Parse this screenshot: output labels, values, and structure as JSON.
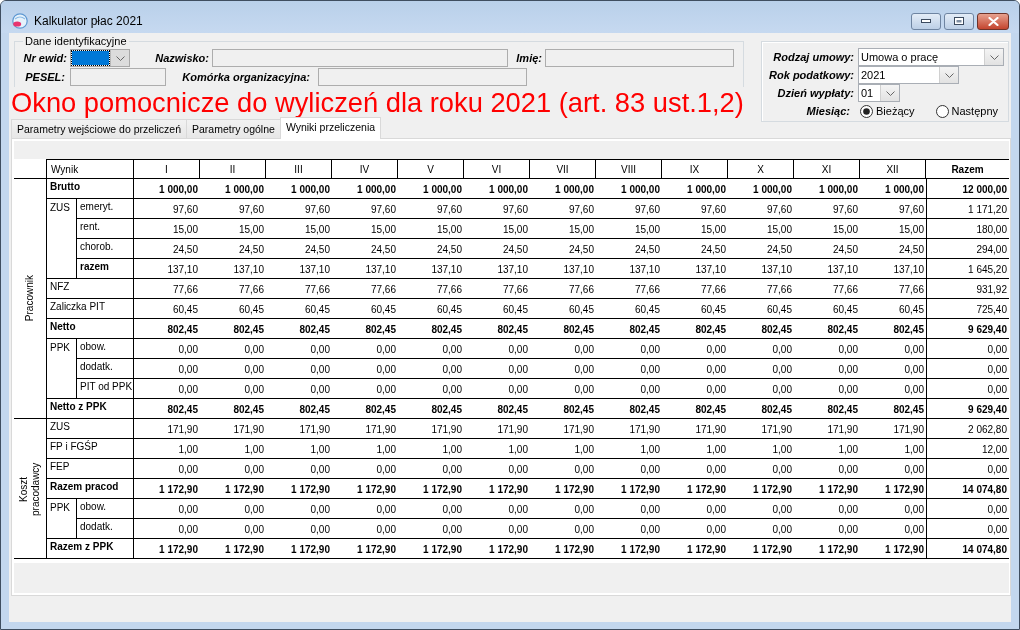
{
  "window": {
    "title": "Kalkulator płac 2021"
  },
  "identification": {
    "legend": "Dane identyfikacyjne",
    "rows": [
      [
        {
          "label": "Nr ewid:",
          "kind": "combo",
          "focused": true
        },
        {
          "label": "Nazwisko:",
          "kind": "text",
          "focused": false
        },
        {
          "label": "Imię:",
          "kind": "text",
          "focused": false
        }
      ],
      [
        {
          "label": "PESEL:",
          "kind": "text",
          "focused": false
        },
        {
          "label": "Komórka organizacyjna:",
          "kind": "text",
          "focused": false
        }
      ]
    ]
  },
  "heading": "Okno pomocnicze do wyliczeń dla roku 2021 (art. 83 ust.1,2)",
  "settings": {
    "fields": [
      {
        "label": "Rodzaj umowy:",
        "kind": "combo",
        "value": "Umowa o pracę"
      },
      {
        "label": "Rok podatkowy:",
        "kind": "combo",
        "value": "2021"
      },
      {
        "label": "Dzień wypłaty:",
        "kind": "combo",
        "value": "01"
      },
      {
        "label": "Miesiąc:",
        "kind": "radio",
        "options": [
          {
            "label": "Bieżący",
            "selected": true
          },
          {
            "label": "Następny",
            "selected": false
          }
        ]
      }
    ]
  },
  "tabs": [
    {
      "label": "Parametry wejściowe do przeliczeń",
      "selected": false
    },
    {
      "label": "Parametry ogólne",
      "selected": false
    },
    {
      "label": "Wyniki przeliczenia",
      "selected": true
    }
  ],
  "results_table": {
    "columns": [
      "Wynik",
      "I",
      "II",
      "III",
      "IV",
      "V",
      "VI",
      "VII",
      "VIII",
      "IX",
      "X",
      "XI",
      "XII",
      "Razem"
    ],
    "groups": [
      {
        "label": "Pracownik",
        "rows": [
          {
            "kind": "total",
            "label": "Brutto",
            "values": [
              "1 000,00",
              "1 000,00",
              "1 000,00",
              "1 000,00",
              "1 000,00",
              "1 000,00",
              "1 000,00",
              "1 000,00",
              "1 000,00",
              "1 000,00",
              "1 000,00",
              "1 000,00",
              "12 000,00"
            ]
          },
          {
            "kind": "group",
            "label": "ZUS",
            "rows": [
              {
                "kind": "item",
                "label": "emeryt.",
                "values": [
                  "97,60",
                  "97,60",
                  "97,60",
                  "97,60",
                  "97,60",
                  "97,60",
                  "97,60",
                  "97,60",
                  "97,60",
                  "97,60",
                  "97,60",
                  "97,60",
                  "1 171,20"
                ]
              },
              {
                "kind": "item",
                "label": "rent.",
                "values": [
                  "15,00",
                  "15,00",
                  "15,00",
                  "15,00",
                  "15,00",
                  "15,00",
                  "15,00",
                  "15,00",
                  "15,00",
                  "15,00",
                  "15,00",
                  "15,00",
                  "180,00"
                ]
              },
              {
                "kind": "item",
                "label": "chorob.",
                "values": [
                  "24,50",
                  "24,50",
                  "24,50",
                  "24,50",
                  "24,50",
                  "24,50",
                  "24,50",
                  "24,50",
                  "24,50",
                  "24,50",
                  "24,50",
                  "24,50",
                  "294,00"
                ]
              },
              {
                "kind": "subtotal",
                "label": "razem",
                "values": [
                  "137,10",
                  "137,10",
                  "137,10",
                  "137,10",
                  "137,10",
                  "137,10",
                  "137,10",
                  "137,10",
                  "137,10",
                  "137,10",
                  "137,10",
                  "137,10",
                  "1 645,20"
                ]
              }
            ]
          },
          {
            "kind": "item",
            "label": "NFZ",
            "values": [
              "77,66",
              "77,66",
              "77,66",
              "77,66",
              "77,66",
              "77,66",
              "77,66",
              "77,66",
              "77,66",
              "77,66",
              "77,66",
              "77,66",
              "931,92"
            ]
          },
          {
            "kind": "item",
            "label": "Zaliczka PIT",
            "values": [
              "60,45",
              "60,45",
              "60,45",
              "60,45",
              "60,45",
              "60,45",
              "60,45",
              "60,45",
              "60,45",
              "60,45",
              "60,45",
              "60,45",
              "725,40"
            ]
          },
          {
            "kind": "total",
            "label": "Netto",
            "values": [
              "802,45",
              "802,45",
              "802,45",
              "802,45",
              "802,45",
              "802,45",
              "802,45",
              "802,45",
              "802,45",
              "802,45",
              "802,45",
              "802,45",
              "9 629,40"
            ]
          },
          {
            "kind": "group",
            "label": "PPK",
            "rows": [
              {
                "kind": "item",
                "label": "obow.",
                "values": [
                  "0,00",
                  "0,00",
                  "0,00",
                  "0,00",
                  "0,00",
                  "0,00",
                  "0,00",
                  "0,00",
                  "0,00",
                  "0,00",
                  "0,00",
                  "0,00",
                  "0,00"
                ]
              },
              {
                "kind": "item",
                "label": "dodatk.",
                "values": [
                  "0,00",
                  "0,00",
                  "0,00",
                  "0,00",
                  "0,00",
                  "0,00",
                  "0,00",
                  "0,00",
                  "0,00",
                  "0,00",
                  "0,00",
                  "0,00",
                  "0,00"
                ]
              },
              {
                "kind": "item",
                "label": "PIT od PPK",
                "values": [
                  "0,00",
                  "0,00",
                  "0,00",
                  "0,00",
                  "0,00",
                  "0,00",
                  "0,00",
                  "0,00",
                  "0,00",
                  "0,00",
                  "0,00",
                  "0,00",
                  "0,00"
                ]
              }
            ]
          },
          {
            "kind": "total",
            "label": "Netto z PPK",
            "values": [
              "802,45",
              "802,45",
              "802,45",
              "802,45",
              "802,45",
              "802,45",
              "802,45",
              "802,45",
              "802,45",
              "802,45",
              "802,45",
              "802,45",
              "9 629,40"
            ]
          }
        ]
      },
      {
        "label": "Koszt pracodawcy",
        "rows": [
          {
            "kind": "item",
            "label": "ZUS",
            "values": [
              "171,90",
              "171,90",
              "171,90",
              "171,90",
              "171,90",
              "171,90",
              "171,90",
              "171,90",
              "171,90",
              "171,90",
              "171,90",
              "171,90",
              "2 062,80"
            ]
          },
          {
            "kind": "item",
            "label": "FP i FGŚP",
            "values": [
              "1,00",
              "1,00",
              "1,00",
              "1,00",
              "1,00",
              "1,00",
              "1,00",
              "1,00",
              "1,00",
              "1,00",
              "1,00",
              "1,00",
              "12,00"
            ]
          },
          {
            "kind": "item",
            "label": "FEP",
            "values": [
              "0,00",
              "0,00",
              "0,00",
              "0,00",
              "0,00",
              "0,00",
              "0,00",
              "0,00",
              "0,00",
              "0,00",
              "0,00",
              "0,00",
              "0,00"
            ]
          },
          {
            "kind": "total",
            "label": "Razem pracod",
            "values": [
              "1 172,90",
              "1 172,90",
              "1 172,90",
              "1 172,90",
              "1 172,90",
              "1 172,90",
              "1 172,90",
              "1 172,90",
              "1 172,90",
              "1 172,90",
              "1 172,90",
              "1 172,90",
              "14 074,80"
            ]
          },
          {
            "kind": "group",
            "label": "PPK",
            "rows": [
              {
                "kind": "item",
                "label": "obow.",
                "values": [
                  "0,00",
                  "0,00",
                  "0,00",
                  "0,00",
                  "0,00",
                  "0,00",
                  "0,00",
                  "0,00",
                  "0,00",
                  "0,00",
                  "0,00",
                  "0,00",
                  "0,00"
                ]
              },
              {
                "kind": "item",
                "label": "dodatk.",
                "values": [
                  "0,00",
                  "0,00",
                  "0,00",
                  "0,00",
                  "0,00",
                  "0,00",
                  "0,00",
                  "0,00",
                  "0,00",
                  "0,00",
                  "0,00",
                  "0,00",
                  "0,00"
                ]
              }
            ]
          },
          {
            "kind": "total",
            "label": "Razem z PPK",
            "values": [
              "1 172,90",
              "1 172,90",
              "1 172,90",
              "1 172,90",
              "1 172,90",
              "1 172,90",
              "1 172,90",
              "1 172,90",
              "1 172,90",
              "1 172,90",
              "1 172,90",
              "1 172,90",
              "14 074,80"
            ]
          }
        ]
      }
    ]
  }
}
